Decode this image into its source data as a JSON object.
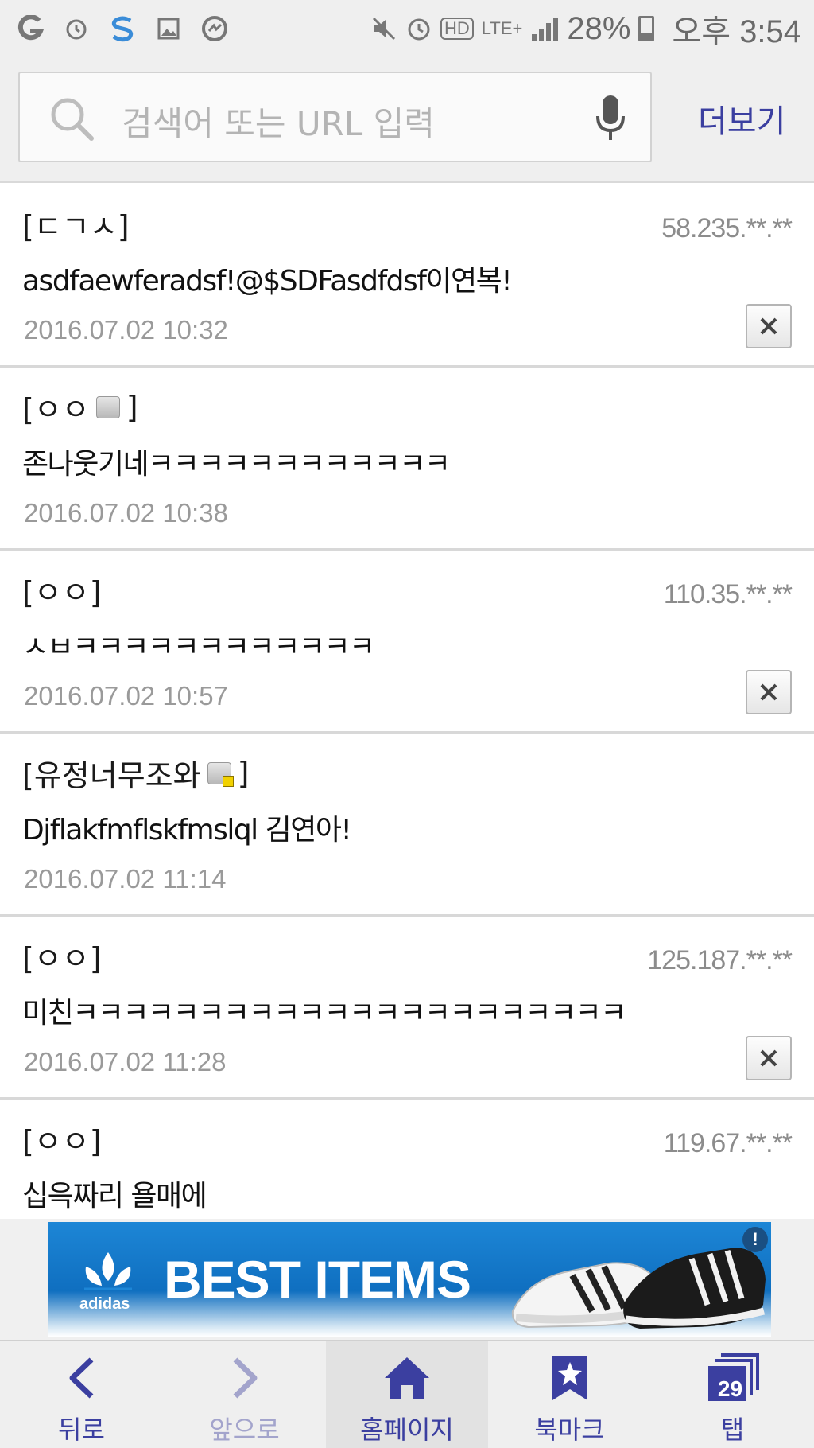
{
  "status_bar": {
    "battery_percent": "28%",
    "time": "오후 3:54",
    "network": "LTE+",
    "hd": "HD",
    "icons": [
      "g-app-icon",
      "alarm-icon",
      "s-app-icon",
      "gallery-icon",
      "messenger-icon",
      "mute-icon",
      "alarm-icon",
      "hd-voice-icon",
      "lte-icon",
      "signal-icon",
      "battery-icon"
    ]
  },
  "address_bar": {
    "placeholder": "검색어 또는 URL 입력",
    "more_label": "더보기"
  },
  "comments": [
    {
      "nick": "[ㄷㄱㅅ]",
      "badge": null,
      "ip": "58.235.**.**",
      "text": "asdfaewferadsf!@$SDFasdfdsf이연복!",
      "date": "2016.07.02 10:32",
      "deletable": true
    },
    {
      "nick": "[ㅇㅇ",
      "nick_end": "]",
      "badge": "member",
      "ip": "",
      "text": "존나웃기네ㅋㅋㅋㅋㅋㅋㅋㅋㅋㅋㅋㅋ",
      "date": "2016.07.02 10:38",
      "deletable": false
    },
    {
      "nick": "[ㅇㅇ]",
      "badge": null,
      "ip": "110.35.**.**",
      "text": "ㅅㅂㅋㅋㅋㅋㅋㅋㅋㅋㅋㅋㅋㅋ",
      "date": "2016.07.02 10:57",
      "deletable": true
    },
    {
      "nick": "[유정너무조와",
      "nick_end": "]",
      "badge": "member-locked",
      "ip": "",
      "text": "Djflakfmflskfmslql 김연아!",
      "date": "2016.07.02 11:14",
      "deletable": false
    },
    {
      "nick": "[ㅇㅇ]",
      "badge": null,
      "ip": "125.187.**.**",
      "text": "미친ㅋㅋㅋㅋㅋㅋㅋㅋㅋㅋㅋㅋㅋㅋㅋㅋㅋㅋㅋㅋㅋㅋ",
      "date": "2016.07.02 11:28",
      "deletable": true
    },
    {
      "nick": "[ㅇㅇ]",
      "badge": null,
      "ip": "119.67.**.**",
      "text": "십윽짜리 욜매에",
      "date": "",
      "deletable": false
    }
  ],
  "ad": {
    "brand": "adidas",
    "title": "BEST ITEMS",
    "info_mark": "!"
  },
  "bottom_nav": [
    {
      "label": "뒤로",
      "icon": "back-arrow-icon",
      "enabled": true,
      "active": false
    },
    {
      "label": "앞으로",
      "icon": "forward-arrow-icon",
      "enabled": false,
      "active": false
    },
    {
      "label": "홈페이지",
      "icon": "home-icon",
      "enabled": true,
      "active": true
    },
    {
      "label": "북마크",
      "icon": "bookmark-star-icon",
      "enabled": true,
      "active": false
    },
    {
      "label": "탭",
      "icon": "tabs-icon",
      "enabled": true,
      "active": false,
      "tab_count": "29"
    }
  ],
  "colors": {
    "accent": "#3b3fa0",
    "ad_blue": "#1d86d6",
    "muted_text": "#9a9a9a"
  }
}
